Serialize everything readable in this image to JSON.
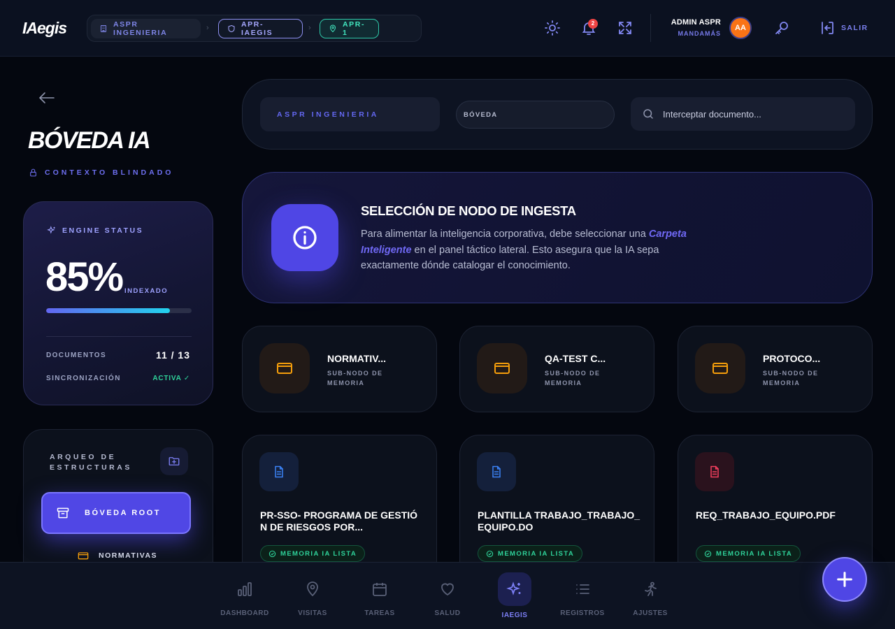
{
  "app": {
    "logo": "IAegis"
  },
  "breadcrumb": {
    "items": [
      {
        "label": "ASPR INGENIERIA",
        "icon": "building-icon"
      },
      {
        "label": "APR-IAEGIS",
        "icon": "shield-icon"
      },
      {
        "label": "APR-1",
        "icon": "map-pin-icon"
      }
    ]
  },
  "header": {
    "notifications_count": "2",
    "user_name": "ADMIN ASPR",
    "user_role": "MANDAMÁS",
    "avatar_initials": "AA",
    "logout_label": "SALIR"
  },
  "sidebar": {
    "title": "BÓVEDA IA",
    "context_label": "CONTEXTO BLINDADO",
    "engine": {
      "label": "ENGINE STATUS",
      "percent_text": "85%",
      "percent_value": 0.85,
      "percent_label": "INDEXADO",
      "documents_label": "DOCUMENTOS",
      "documents_value": "11 / 13",
      "sync_label": "SINCRONIZACIÓN",
      "sync_value": "ACTIVA ✓"
    },
    "tree": {
      "title": "ARQUEO DE ESTRUCTURAS",
      "root_label": "BÓVEDA ROOT",
      "children": [
        "NORMATIVAS"
      ]
    }
  },
  "filters": {
    "organization": "ASPR INGENIERIA",
    "vault_select": "BÓVEDA",
    "search_placeholder": "Interceptar documento..."
  },
  "info": {
    "title": "SELECCIÓN DE NODO DE INGESTA",
    "text_before": "Para alimentar la inteligencia corporativa, debe seleccionar una ",
    "text_highlight": "Carpeta Inteligente",
    "text_after": " en el panel táctico lateral. Esto asegura que la IA sepa exactamente dónde catalogar el conocimiento."
  },
  "folders": [
    {
      "name": "NORMATIV...",
      "sub": "SUB-NODO DE MEMORIA"
    },
    {
      "name": "QA-TEST C...",
      "sub": "SUB-NODO DE MEMORIA"
    },
    {
      "name": "PROTOCO...",
      "sub": "SUB-NODO DE MEMORIA"
    }
  ],
  "documents": [
    {
      "name": "PR-SSO- PROGRAMA DE GESTIÓN DE RIESGOS POR...",
      "badge": "MEMORIA IA LISTA",
      "icon_color": "#3b82f6"
    },
    {
      "name": "PLANTILLA TRABAJO_TRABAJO_EQUIPO.DO",
      "badge": "MEMORIA IA LISTA",
      "icon_color": "#3b82f6"
    },
    {
      "name": "REQ_TRABAJO_EQUIPO.PDF",
      "badge": "MEMORIA IA LISTA",
      "icon_color": "#f43f5e"
    }
  ],
  "bottom_nav": [
    {
      "label": "DASHBOARD",
      "icon": "bar-chart-icon"
    },
    {
      "label": "VISITAS",
      "icon": "map-pin-icon"
    },
    {
      "label": "TAREAS",
      "icon": "calendar-icon"
    },
    {
      "label": "SALUD",
      "icon": "heart-icon"
    },
    {
      "label": "IAEGIS",
      "icon": "sparkles-icon",
      "active": true
    },
    {
      "label": "REGISTROS",
      "icon": "list-icon"
    },
    {
      "label": "AJUSTES",
      "icon": "person-running-icon"
    }
  ],
  "colors": {
    "accent": "#4f46e5",
    "accent_text": "#7c7ff5",
    "success": "#2fd39a",
    "folder": "#f59e0b",
    "background": "#04070f"
  }
}
